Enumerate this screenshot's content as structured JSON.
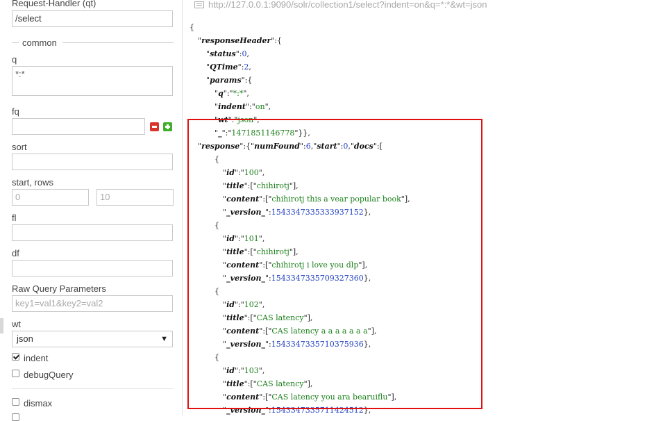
{
  "form": {
    "request_handler_label": "Request-Handler (qt)",
    "request_handler_value": "/select",
    "common_label": "common",
    "q_label": "q",
    "q_value": "*:*",
    "fq_label": "fq",
    "sort_label": "sort",
    "start_rows_label": "start, rows",
    "start_placeholder": "0",
    "rows_placeholder": "10",
    "fl_label": "fl",
    "df_label": "df",
    "raw_label": "Raw Query Parameters",
    "raw_placeholder": "key1=val1&key2=val2",
    "wt_label": "wt",
    "wt_value": "json",
    "indent_label": "indent",
    "indent_checked": true,
    "debug_label": "debugQuery",
    "dismax_label": "dismax",
    "icons": [
      "remove-fq-icon",
      "add-fq-icon",
      "checkbox-icon",
      "select-arrow-icon"
    ]
  },
  "response": {
    "url": "http://127.0.0.1:9090/solr/collection1/select?indent=on&q=*:*&wt=json",
    "header": {
      "status": "0",
      "QTime": "2",
      "params": {
        "q": "*:*",
        "indent": "on",
        "wt": "json",
        "_": "1471851146778"
      }
    },
    "numFound": "6",
    "start": "0",
    "docs": [
      {
        "id": "100",
        "title": "chihirotj",
        "content": "chihirotj this a vear popular book",
        "version": "1543347335333937152"
      },
      {
        "id": "101",
        "title": "chihirotj",
        "content": "chihirotj i love you dlp",
        "version": "1543347335709327360"
      },
      {
        "id": "102",
        "title": "CAS latency",
        "content": "CAS latency a a a a a a a",
        "version": "1543347335710375936"
      },
      {
        "id": "103",
        "title": "CAS latency",
        "content": "CAS latency you ara bearuiflu",
        "version": "1543347335711424512"
      }
    ],
    "highlight_color": "#e01010",
    "key_color": "#111111",
    "string_color": "#1a7f1a",
    "number_color": "#1f3fbf"
  }
}
